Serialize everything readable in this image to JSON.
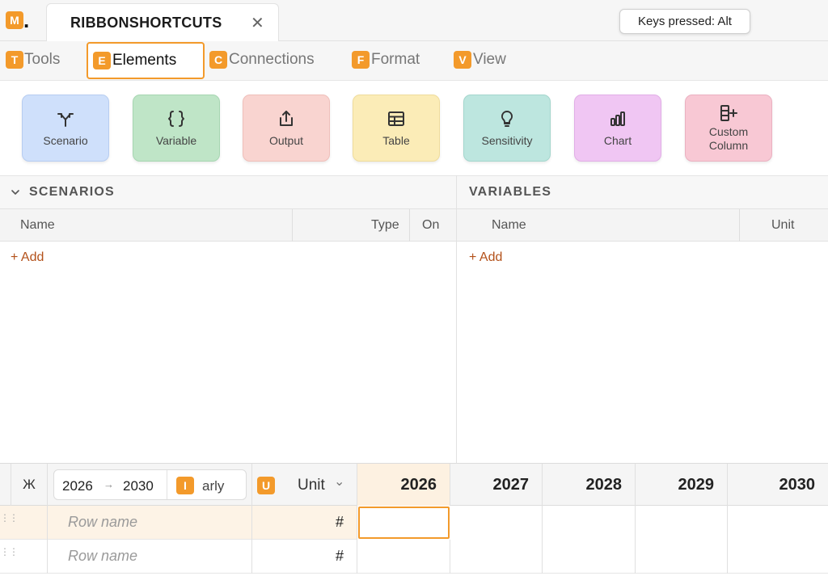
{
  "app": {
    "logo_tip": "M",
    "logo_dot": ".",
    "tab_title": "RIBBONSHORTCUTS",
    "tab_close": "✕",
    "keys_pressed": "Keys pressed: Alt"
  },
  "menu": [
    {
      "tip": "T",
      "label": "Tools"
    },
    {
      "tip": "E",
      "label": "Elements"
    },
    {
      "tip": "C",
      "label": "Connections"
    },
    {
      "tip": "F",
      "label": "Format"
    },
    {
      "tip": "V",
      "label": "View"
    }
  ],
  "ribbon": [
    {
      "label": "Scenario",
      "icon": "scenario-icon"
    },
    {
      "label": "Variable",
      "icon": "braces-icon"
    },
    {
      "label": "Output",
      "icon": "share-icon"
    },
    {
      "label": "Table",
      "icon": "table-icon"
    },
    {
      "label": "Sensitivity",
      "icon": "lightbulb-icon"
    },
    {
      "label": "Chart",
      "icon": "bar-chart-icon"
    },
    {
      "label": "Custom Column",
      "icon": "add-column-icon"
    }
  ],
  "scenarios": {
    "title": "SCENARIOS",
    "col_name": "Name",
    "col_type": "Type",
    "col_on": "On",
    "add": "+ Add"
  },
  "variables": {
    "title": "VARIABLES",
    "col_name": "Name",
    "col_unit": "Unit",
    "add": "+ Add"
  },
  "grid": {
    "corner_glyph": "Ж",
    "range_start": "2026",
    "range_arrow": "→",
    "range_end": "2030",
    "period_tip": "I",
    "period_text": "arly",
    "unit_tip": "U",
    "unit_label": "Unit",
    "unit_chevron": "⌄",
    "years": [
      "2026",
      "2027",
      "2028",
      "2029",
      "2030"
    ],
    "rows": [
      {
        "name": "Row name",
        "unit": "#"
      },
      {
        "name": "Row name",
        "unit": "#"
      }
    ]
  },
  "colors": {
    "accent": "#f39a2b",
    "add_link": "#b3511a"
  }
}
